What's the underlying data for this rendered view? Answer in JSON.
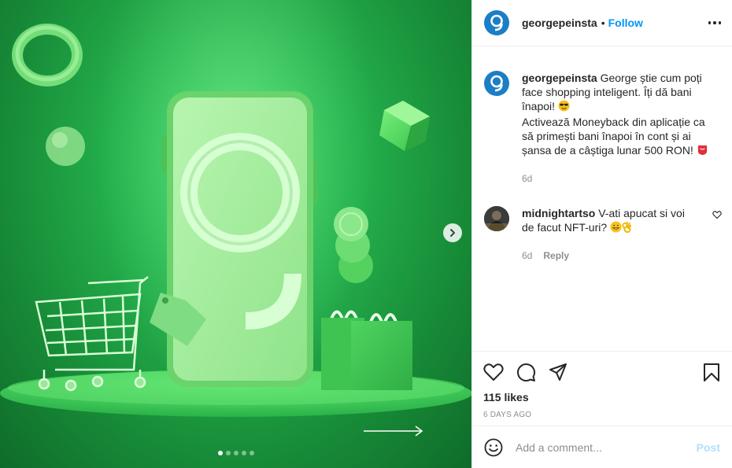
{
  "post": {
    "username": "georgepeinsta",
    "follow_label": "Follow",
    "separator": "•",
    "caption_line1": "George știe cum poți face shopping inteligent. Îți dă bani înapoi!",
    "caption_line2": "Activează Moneyback din aplicație ca să primești bani înapoi în cont și ai șansa de a câștiga lunar 500 RON!",
    "caption_age": "6d",
    "brand_color": "#1b7ec6"
  },
  "comments": [
    {
      "username": "midnightartso",
      "text": "V-ati apucat si voi de facut NFT-uri?",
      "age": "6d",
      "reply_label": "Reply"
    }
  ],
  "carousel": {
    "slide_count": 5,
    "active_index": 0
  },
  "stats": {
    "likes": "115 likes",
    "posted": "6 DAYS AGO"
  },
  "composer": {
    "placeholder": "Add a comment...",
    "post_label": "Post"
  },
  "icons": [
    "heart-icon",
    "comment-icon",
    "share-icon",
    "bookmark-icon",
    "emoji-icon",
    "more-icon",
    "chevron-right-icon",
    "arrow-right-icon"
  ]
}
